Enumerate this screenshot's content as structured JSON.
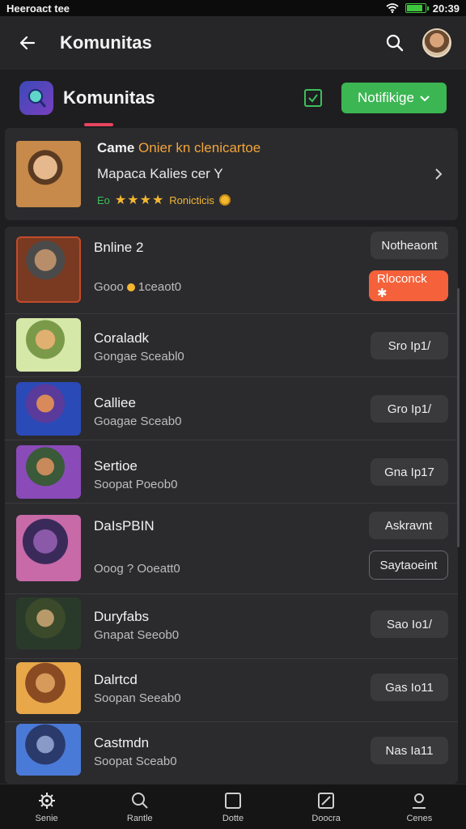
{
  "status": {
    "left": "Heeroact tee",
    "time": "20:39",
    "battery_level": 0.85
  },
  "app_bar": {
    "title": "Komunitas"
  },
  "community": {
    "name": "Komunitas",
    "notify_label": "Notifikige"
  },
  "featured": {
    "title_prefix": "Came ",
    "title_highlight": "Onier kn clenicartoe",
    "subtitle": "Mapaca Kalies cer Y",
    "code": "Eo",
    "stars": "★★★★",
    "rating_label": "Ronicticis"
  },
  "rows": [
    {
      "name": "Bnline 2",
      "sub_a": "Gooo",
      "sub_b": "1ceaot0",
      "top_button": "Notheaont",
      "bottom_button": "Rloconck ✱"
    },
    {
      "name": "Coraladk",
      "sub": "Gongae Sceabl0",
      "button": "Sro Ip1/"
    },
    {
      "name": "Calliee",
      "sub": "Goagae Sceab0",
      "button": "Gro Ip1/"
    },
    {
      "name": "Sertioe",
      "sub": "Soopat Poeob0",
      "button": "Gna Ip17"
    },
    {
      "name": "DaIsPBIN",
      "sub": "Ooog ? Ooeatt0",
      "top_button": "Askravnt",
      "bottom_button": "Saytaoeint"
    },
    {
      "name": "Duryfabs",
      "sub": "Gnapat Seeob0",
      "button": "Sao Io1/"
    },
    {
      "name": "Dalrtcd",
      "sub": "Soopan Seeab0",
      "button": "Gas Io11"
    },
    {
      "name": "Castmdn",
      "sub": "Soopat Sceab0",
      "button": "Nas Ia11"
    }
  ],
  "nav": [
    "Senie",
    "Rantle",
    "Dotte",
    "Doocra",
    "Cenes"
  ],
  "colors": {
    "accent_green": "#3cb653",
    "accent_orange": "#f4613a",
    "highlight_gold": "#f3a43a",
    "tab_indicator": "#e8455f"
  }
}
